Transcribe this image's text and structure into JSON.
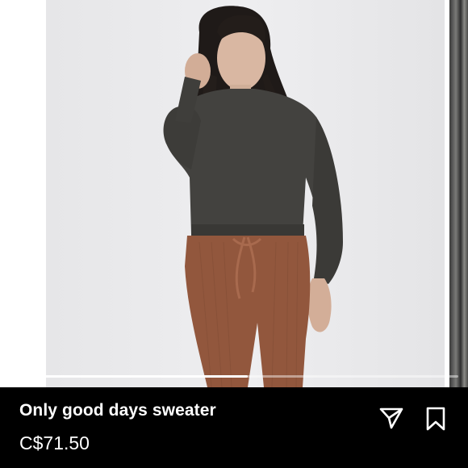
{
  "product": {
    "title": "Only good days sweater",
    "price": "C$71.50"
  },
  "carousel": {
    "image_description_icon": "product-photo",
    "progress": 0.53
  },
  "actions": {
    "share_icon": "paper-plane-icon",
    "save_icon": "bookmark-icon"
  },
  "colors": {
    "info_bar_background": "#000000",
    "text": "#ffffff",
    "sweater": "#43423f",
    "pants": "#92573d"
  }
}
